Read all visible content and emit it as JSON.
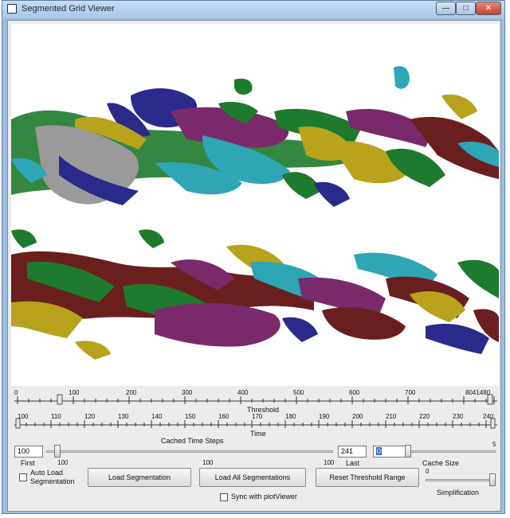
{
  "window": {
    "title": "Segmented Grid Viewer",
    "minimize_glyph": "—",
    "maximize_glyph": "□",
    "close_glyph": "✕"
  },
  "threshold_ruler": {
    "label": "Threshold",
    "tick_labels": [
      "0",
      "100",
      "200",
      "300",
      "400",
      "500",
      "600",
      "700",
      "8041480"
    ]
  },
  "time_ruler": {
    "label": "Time",
    "tick_labels": [
      "100",
      "110",
      "120",
      "130",
      "140",
      "150",
      "160",
      "170",
      "180",
      "190",
      "200",
      "210",
      "220",
      "230",
      "240"
    ]
  },
  "cached_time_steps": {
    "label": "Cached Time Steps",
    "first_value": "100",
    "last_value": "241",
    "first_label": "First",
    "last_label": "Last",
    "slider_under_label": "100",
    "mid_label": "100",
    "right_under_label": "100"
  },
  "cache_size": {
    "value": "0",
    "label": "Cache Size",
    "max_label": "5"
  },
  "simplification": {
    "label": "Simplification",
    "min_label": "0"
  },
  "controls": {
    "auto_load_label": "Auto Load Segmentation",
    "load_segmentation": "Load Segmentation",
    "load_all_segmentations": "Load All Segmentations",
    "reset_threshold_range": "Reset Threshold Range",
    "sync_label": "Sync with plotViewer"
  },
  "colors": {
    "window_frame": "#9ebfe0",
    "segment_palette": [
      "#1e7a2c",
      "#7a2a6b",
      "#2a2a8a",
      "#b9a21c",
      "#2ea6b5",
      "#6a1f1f",
      "#9a9a9a",
      "#3f6a1a"
    ]
  }
}
